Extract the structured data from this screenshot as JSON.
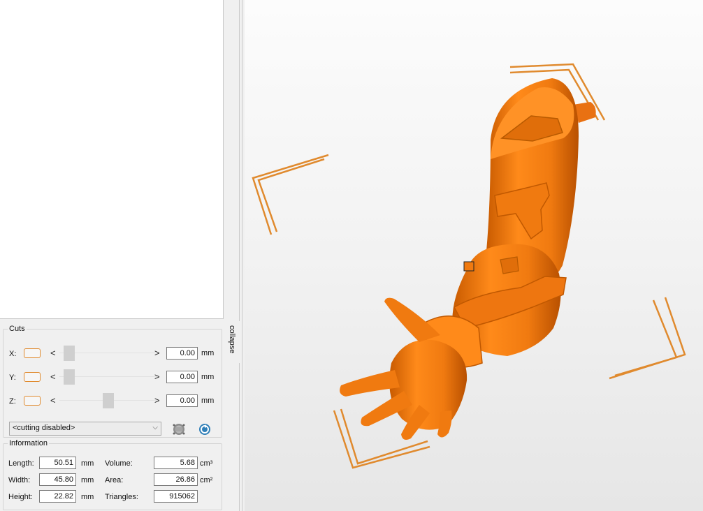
{
  "cuts": {
    "title": "Cuts",
    "rows": [
      {
        "axis": "X:",
        "value": "0.00",
        "unit": "mm",
        "slider_fraction": 0.05
      },
      {
        "axis": "Y:",
        "value": "0.00",
        "unit": "mm",
        "slider_fraction": 0.05
      },
      {
        "axis": "Z:",
        "value": "0.00",
        "unit": "mm",
        "slider_fraction": 0.5
      }
    ],
    "mode_select": "<cutting disabled>",
    "left_arrow": "<",
    "right_arrow": ">"
  },
  "info": {
    "title": "Information",
    "length": {
      "label": "Length:",
      "value": "50.51",
      "unit": "mm"
    },
    "width": {
      "label": "Width:",
      "value": "45.80",
      "unit": "mm"
    },
    "height": {
      "label": "Height:",
      "value": "22.82",
      "unit": "mm"
    },
    "volume": {
      "label": "Volume:",
      "value": "5.68",
      "unit": "cm³"
    },
    "area": {
      "label": "Area:",
      "value": "26.86",
      "unit": "cm²"
    },
    "triangles": {
      "label": "Triangles:",
      "value": "915062"
    }
  },
  "collapse_label": "collapse",
  "colors": {
    "model": "#f07a10",
    "model_dark": "#c85a00",
    "bbox": "#e08a2e"
  }
}
